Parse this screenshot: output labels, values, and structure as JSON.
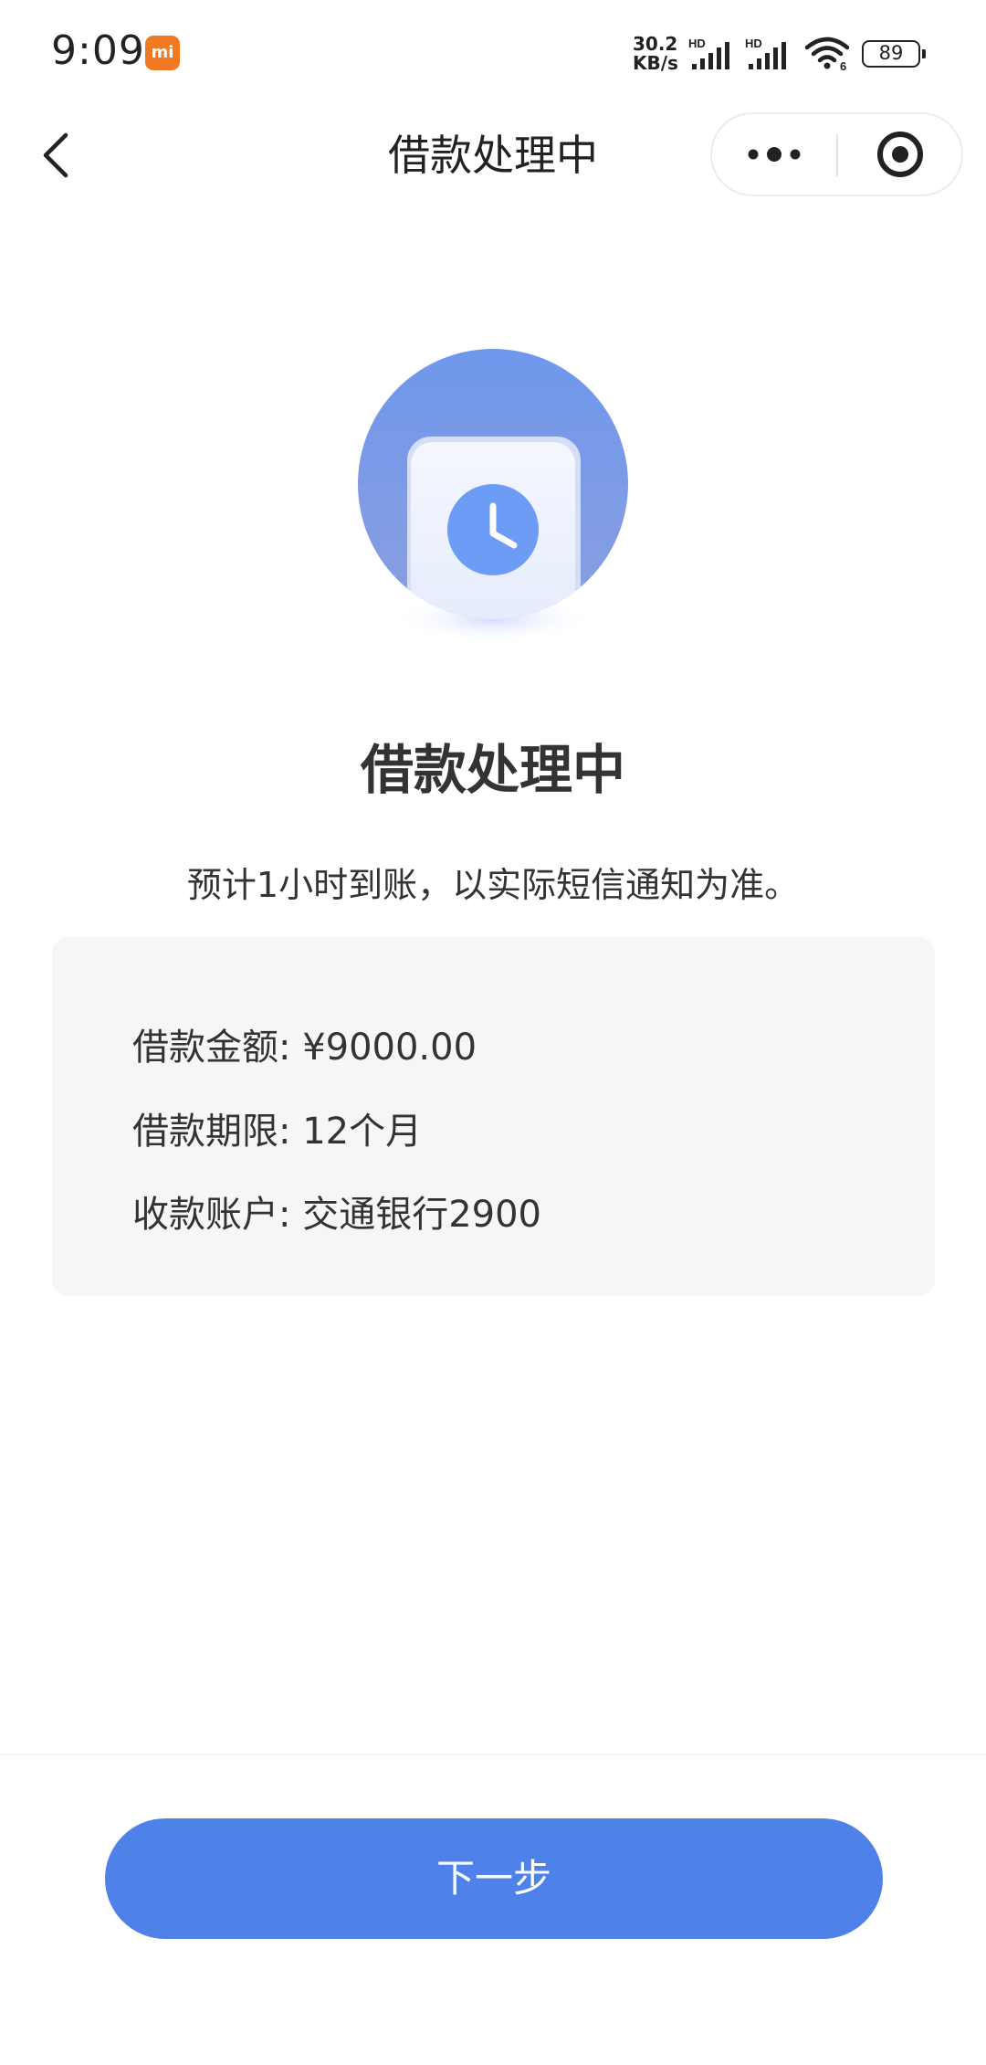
{
  "status_bar": {
    "time": "9:09",
    "mi_badge": "mi",
    "net_speed_value": "30.2",
    "net_speed_unit": "KB/s",
    "signal_label": "HD",
    "wifi_label": "6",
    "battery": "89"
  },
  "nav": {
    "title": "借款处理中",
    "icons": [
      "back-arrow",
      "more-dots",
      "target-circle"
    ]
  },
  "main": {
    "illustration": "clock-icon",
    "status_title": "借款处理中",
    "status_desc": "预计1小时到账，以实际短信通知为准。"
  },
  "info": {
    "amount": "借款金额: ¥9000.00",
    "term": "借款期限: 12个月",
    "account": "收款账户: 交通银行2900"
  },
  "footer": {
    "next_label": "下一步"
  },
  "colors": {
    "accent": "#4e82e8",
    "card_bg": "#f6f6f6",
    "mi_badge": "#f07a23"
  }
}
